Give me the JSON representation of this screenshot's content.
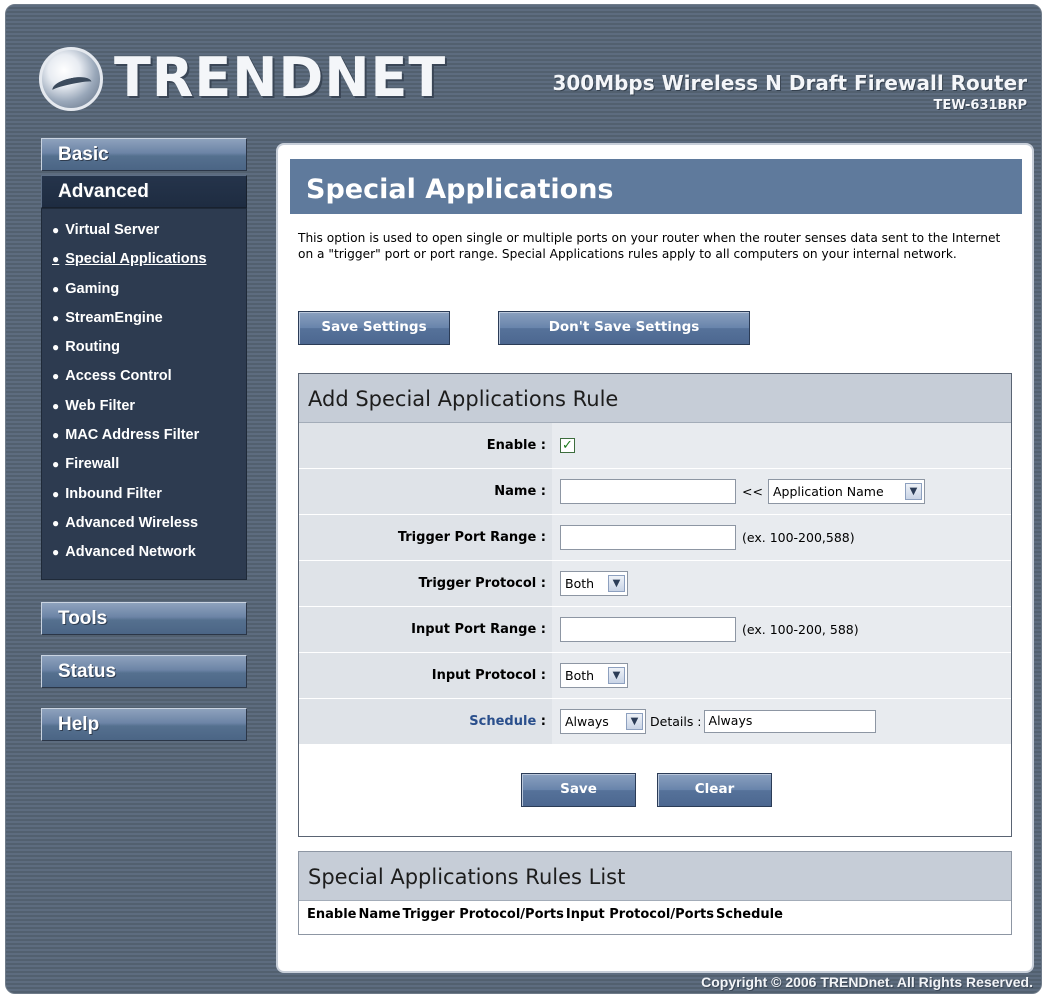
{
  "header": {
    "brand": "TRENDNET",
    "product_title": "300Mbps Wireless N Draft Firewall Router",
    "model": "TEW-631BRP"
  },
  "sidebar": {
    "basic": "Basic",
    "advanced": "Advanced",
    "items": [
      {
        "label": "Virtual Server"
      },
      {
        "label": "Special Applications"
      },
      {
        "label": "Gaming"
      },
      {
        "label": "StreamEngine"
      },
      {
        "label": "Routing"
      },
      {
        "label": "Access Control"
      },
      {
        "label": "Web Filter"
      },
      {
        "label": "MAC Address Filter"
      },
      {
        "label": "Firewall"
      },
      {
        "label": "Inbound Filter"
      },
      {
        "label": "Advanced Wireless"
      },
      {
        "label": "Advanced Network"
      }
    ],
    "tools": "Tools",
    "status": "Status",
    "help": "Help"
  },
  "main": {
    "title": "Special Applications",
    "intro": "This option is used to open single or multiple ports on your router when the router senses data sent to the Internet on a \"trigger\" port or port range. Special Applications rules apply to all computers on your internal network.",
    "save_settings": "Save Settings",
    "dont_save_settings": "Don't Save Settings",
    "rule": {
      "heading": "Add Special Applications Rule",
      "enable_label": "Enable :",
      "name_label": "Name :",
      "name_value": "",
      "name_sep": "<<",
      "app_name_select": "Application Name",
      "trigger_range_label": "Trigger Port Range :",
      "trigger_range_value": "",
      "trigger_range_hint": "(ex. 100-200,588)",
      "trigger_protocol_label": "Trigger Protocol :",
      "trigger_protocol_value": "Both",
      "input_range_label": "Input Port Range :",
      "input_range_value": "",
      "input_range_hint": "(ex. 100-200, 588)",
      "input_protocol_label": "Input Protocol :",
      "input_protocol_value": "Both",
      "schedule_label": "Schedule",
      "schedule_colon": " :",
      "schedule_value": "Always",
      "details_label": "Details :",
      "details_value": "Always",
      "save": "Save",
      "clear": "Clear"
    },
    "list": {
      "heading": "Special Applications Rules List",
      "columns": [
        "Enable",
        "Name",
        "Trigger Protocol/Ports",
        "Input Protocol/Ports",
        "Schedule"
      ]
    }
  },
  "footer": {
    "copyright": "Copyright © 2006 TRENDnet. All Rights Reserved."
  },
  "colors": {
    "frame": "#5d6c7f",
    "title_bar": "#5f7a9c",
    "nav_active": "#25344b",
    "section_head": "#c6cdd7"
  }
}
